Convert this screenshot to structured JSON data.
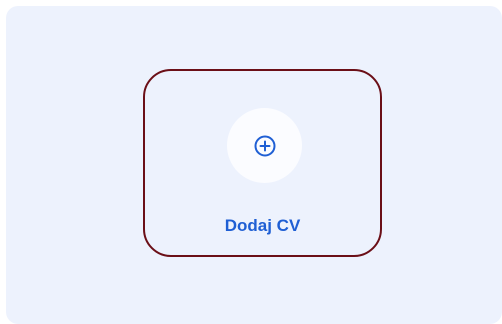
{
  "add_cv": {
    "icon": "plus-circle-icon",
    "label": "Dodaj CV"
  },
  "colors": {
    "panel_background": "#edf2fd",
    "card_border": "#6b0f17",
    "accent": "#1f5fd4",
    "icon_circle_background": "#fbfcff"
  }
}
